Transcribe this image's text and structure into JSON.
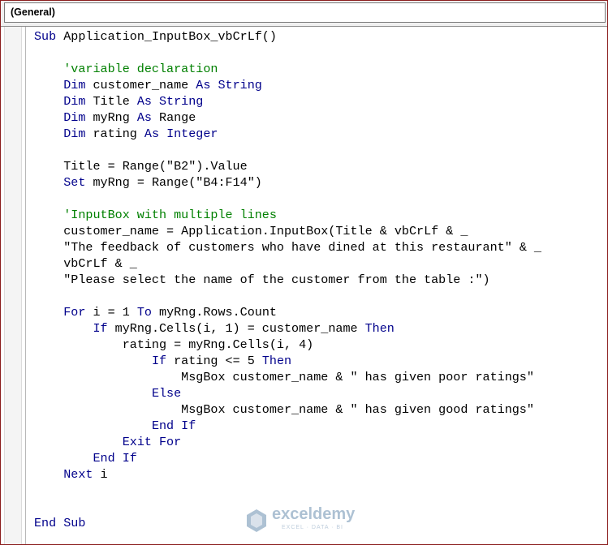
{
  "object_combo": {
    "value": "(General)"
  },
  "code_lines": [
    {
      "indent": 0,
      "parts": [
        {
          "t": "Sub",
          "c": "kw"
        },
        {
          "t": " Application_InputBox_vbCrLf()"
        }
      ]
    },
    {
      "indent": 0,
      "parts": []
    },
    {
      "indent": 4,
      "parts": [
        {
          "t": "'variable declaration",
          "c": "cm"
        }
      ]
    },
    {
      "indent": 4,
      "parts": [
        {
          "t": "Dim",
          "c": "kw"
        },
        {
          "t": " customer_name "
        },
        {
          "t": "As String",
          "c": "kw"
        }
      ]
    },
    {
      "indent": 4,
      "parts": [
        {
          "t": "Dim",
          "c": "kw"
        },
        {
          "t": " Title "
        },
        {
          "t": "As String",
          "c": "kw"
        }
      ]
    },
    {
      "indent": 4,
      "parts": [
        {
          "t": "Dim",
          "c": "kw"
        },
        {
          "t": " myRng "
        },
        {
          "t": "As",
          "c": "kw"
        },
        {
          "t": " Range"
        }
      ]
    },
    {
      "indent": 4,
      "parts": [
        {
          "t": "Dim",
          "c": "kw"
        },
        {
          "t": " rating "
        },
        {
          "t": "As Integer",
          "c": "kw"
        }
      ]
    },
    {
      "indent": 0,
      "parts": []
    },
    {
      "indent": 4,
      "parts": [
        {
          "t": "Title = Range(\"B2\").Value"
        }
      ]
    },
    {
      "indent": 4,
      "parts": [
        {
          "t": "Set",
          "c": "kw"
        },
        {
          "t": " myRng = Range(\"B4:F14\")"
        }
      ]
    },
    {
      "indent": 0,
      "parts": []
    },
    {
      "indent": 4,
      "parts": [
        {
          "t": "'InputBox with multiple lines",
          "c": "cm"
        }
      ]
    },
    {
      "indent": 4,
      "parts": [
        {
          "t": "customer_name = Application.InputBox(Title & vbCrLf & _"
        }
      ]
    },
    {
      "indent": 4,
      "parts": [
        {
          "t": "\"The feedback of customers who have dined at this restaurant\" & _"
        }
      ]
    },
    {
      "indent": 4,
      "parts": [
        {
          "t": "vbCrLf & _"
        }
      ]
    },
    {
      "indent": 4,
      "parts": [
        {
          "t": "\"Please select the name of the customer from the table :\")"
        }
      ]
    },
    {
      "indent": 0,
      "parts": []
    },
    {
      "indent": 4,
      "parts": [
        {
          "t": "For",
          "c": "kw"
        },
        {
          "t": " i = 1 "
        },
        {
          "t": "To",
          "c": "kw"
        },
        {
          "t": " myRng.Rows.Count"
        }
      ]
    },
    {
      "indent": 8,
      "parts": [
        {
          "t": "If",
          "c": "kw"
        },
        {
          "t": " myRng.Cells(i, 1) = customer_name "
        },
        {
          "t": "Then",
          "c": "kw"
        }
      ]
    },
    {
      "indent": 12,
      "parts": [
        {
          "t": "rating = myRng.Cells(i, 4)"
        }
      ]
    },
    {
      "indent": 16,
      "parts": [
        {
          "t": "If",
          "c": "kw"
        },
        {
          "t": " rating <= 5 "
        },
        {
          "t": "Then",
          "c": "kw"
        }
      ]
    },
    {
      "indent": 20,
      "parts": [
        {
          "t": "MsgBox customer_name & \" has given poor ratings\""
        }
      ]
    },
    {
      "indent": 16,
      "parts": [
        {
          "t": "Else",
          "c": "kw"
        }
      ]
    },
    {
      "indent": 20,
      "parts": [
        {
          "t": "MsgBox customer_name & \" has given good ratings\""
        }
      ]
    },
    {
      "indent": 16,
      "parts": [
        {
          "t": "End If",
          "c": "kw"
        }
      ]
    },
    {
      "indent": 12,
      "parts": [
        {
          "t": "Exit For",
          "c": "kw"
        }
      ]
    },
    {
      "indent": 8,
      "parts": [
        {
          "t": "End If",
          "c": "kw"
        }
      ]
    },
    {
      "indent": 4,
      "parts": [
        {
          "t": "Next",
          "c": "kw"
        },
        {
          "t": " i"
        }
      ]
    },
    {
      "indent": 0,
      "parts": []
    },
    {
      "indent": 0,
      "parts": []
    },
    {
      "indent": 0,
      "parts": [
        {
          "t": "End Sub",
          "c": "kw"
        }
      ]
    }
  ],
  "colors": {
    "keyword": "#00008b",
    "comment": "#008000",
    "text": "#000000",
    "frame_border": "#8a1c1c"
  },
  "watermark": {
    "icon": "exceldemy-logo-icon",
    "name": "exceldemy",
    "tagline": "EXCEL · DATA · BI"
  }
}
